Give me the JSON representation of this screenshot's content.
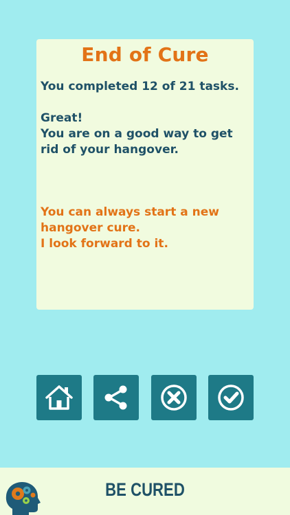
{
  "dialog": {
    "title": "End of Cure",
    "summary": "You completed 12 of 21 tasks.",
    "praise_line1": "Great!",
    "praise_line2": "You are on a good way to get rid of your hangover.",
    "info_line1": "You can always start a new hangover cure.",
    "info_line2": "I look forward to it."
  },
  "toolbar": {
    "buttons": [
      {
        "icon": "home-icon"
      },
      {
        "icon": "share-icon"
      },
      {
        "icon": "close-circle-icon"
      },
      {
        "icon": "check-circle-icon"
      }
    ]
  },
  "footer": {
    "brand": "BE CURED"
  },
  "colors": {
    "background": "#a0ecef",
    "card": "#f1fbdf",
    "accent_orange": "#e27317",
    "text_blue": "#1f5167",
    "button_teal": "#1e7a87"
  }
}
